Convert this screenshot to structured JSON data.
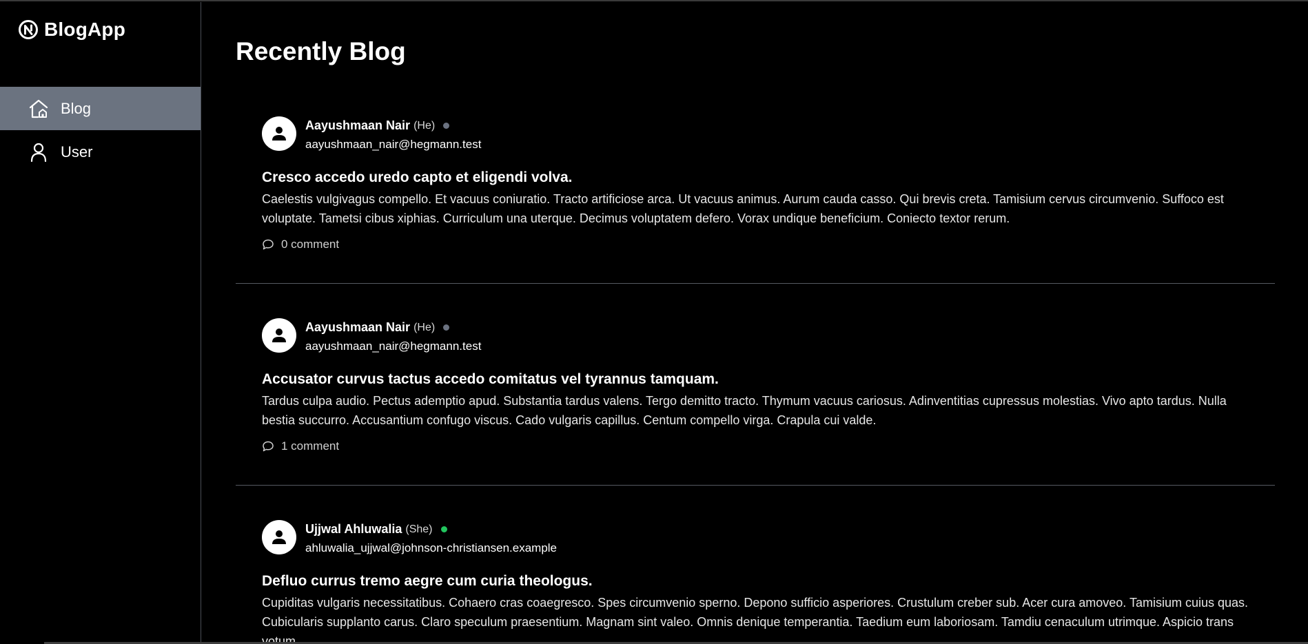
{
  "app": {
    "name": "BlogApp",
    "logo_icon": "brand-logo-icon"
  },
  "sidebar": {
    "items": [
      {
        "label": "Blog",
        "icon": "home-icon",
        "active": true
      },
      {
        "label": "User",
        "icon": "user-icon",
        "active": false
      }
    ]
  },
  "main": {
    "title": "Recently Blog"
  },
  "posts": [
    {
      "author": "Aayushmaan Nair",
      "pronoun": "(He)",
      "status": "offline",
      "email": "aayushmaan_nair@hegmann.test",
      "title": "Cresco accedo uredo capto et eligendi volva.",
      "body": "Caelestis vulgivagus compello. Et vacuus coniuratio. Tracto artificiose arca. Ut vacuus animus. Aurum cauda casso. Qui brevis creta. Tamisium cervus circumvenio. Suffoco est voluptate. Tametsi cibus xiphias. Curriculum una uterque. Decimus voluptatem defero. Vorax undique beneficium. Coniecto textor rerum.",
      "comments": "0 comment"
    },
    {
      "author": "Aayushmaan Nair",
      "pronoun": "(He)",
      "status": "offline",
      "email": "aayushmaan_nair@hegmann.test",
      "title": "Accusator curvus tactus accedo comitatus vel tyrannus tamquam.",
      "body": "Tardus culpa audio. Pectus ademptio apud. Substantia tardus valens. Tergo demitto tracto. Thymum vacuus cariosus. Adinventitias cupressus molestias. Vivo apto tardus. Nulla bestia succurro. Accusantium confugo viscus. Cado vulgaris capillus. Centum compello virga. Crapula cui valde.",
      "comments": "1 comment"
    },
    {
      "author": "Ujjwal Ahluwalia",
      "pronoun": "(She)",
      "status": "online",
      "email": "ahluwalia_ujjwal@johnson-christiansen.example",
      "title": "Defluo currus tremo aegre cum curia theologus.",
      "body": "Cupiditas vulgaris necessitatibus. Cohaero cras coaegresco. Spes circumvenio sperno. Depono sufficio asperiores. Crustulum creber sub. Acer cura amoveo. Tamisium cuius quas. Cubicularis supplanto carus. Claro speculum praesentium. Magnam sint valeo. Omnis denique temperantia. Taedium eum laboriosam. Tamdiu cenaculum utrimque. Aspicio trans votum.",
      "comments": ""
    }
  ],
  "colors": {
    "background": "#000000",
    "active_nav": "#6b7380",
    "online": "#22c55e",
    "offline": "#6b7280",
    "divider": "#565a61"
  }
}
